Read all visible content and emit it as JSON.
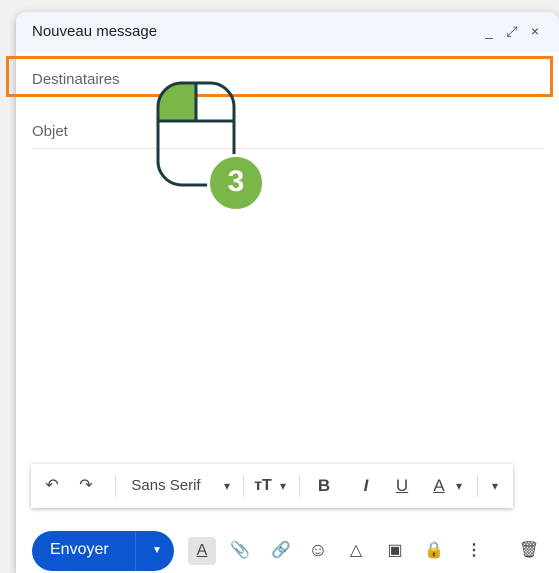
{
  "window": {
    "title": "Nouveau message",
    "controls": {
      "minimize": "_",
      "expand": "⤢",
      "close": "×"
    }
  },
  "fields": {
    "recipients_placeholder": "Destinataires",
    "subject_placeholder": "Objet"
  },
  "formatting": {
    "undo": "↶",
    "redo": "↷",
    "font": "Sans Serif",
    "font_dropdown": "▾",
    "size": "тT",
    "size_dropdown": "▾",
    "bold": "B",
    "italic": "I",
    "underline": "U",
    "text_color": "A",
    "color_dropdown": "▾",
    "more": "▾"
  },
  "bottom_toolbar": {
    "send_label": "Envoyer",
    "send_options": "▼",
    "format_toggle": "A",
    "attach": "📎",
    "link": "🔗",
    "emoji": "☺",
    "drive": "△",
    "photo": "▣",
    "confidential": "🔒",
    "more_options": "⋮",
    "discard": "🗑"
  },
  "annotation": {
    "step_number": "3",
    "highlight_color": "#f0821e",
    "badge_color": "#7ab648"
  }
}
